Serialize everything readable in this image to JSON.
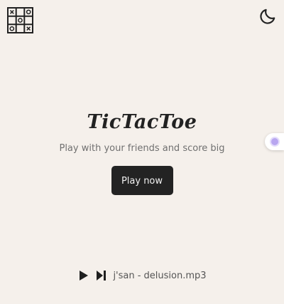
{
  "header": {
    "logo_icon": "tictactoe-grid-icon",
    "theme_toggle_icon": "moon-icon"
  },
  "hero": {
    "title": "TicTacToe",
    "subtitle": "Play with your friends and score big",
    "cta_label": "Play now"
  },
  "side_widget": {
    "icon": "assistant-bubble-icon",
    "accent_color": "#b8a6f0"
  },
  "player": {
    "play_icon": "play-icon",
    "next_icon": "skip-next-icon",
    "track": "j'san - delusion.mp3"
  },
  "colors": {
    "background": "#f5f0eb",
    "button_bg": "#232323",
    "button_text": "#f1f1f1",
    "title": "#222222",
    "subtitle": "#707070"
  }
}
